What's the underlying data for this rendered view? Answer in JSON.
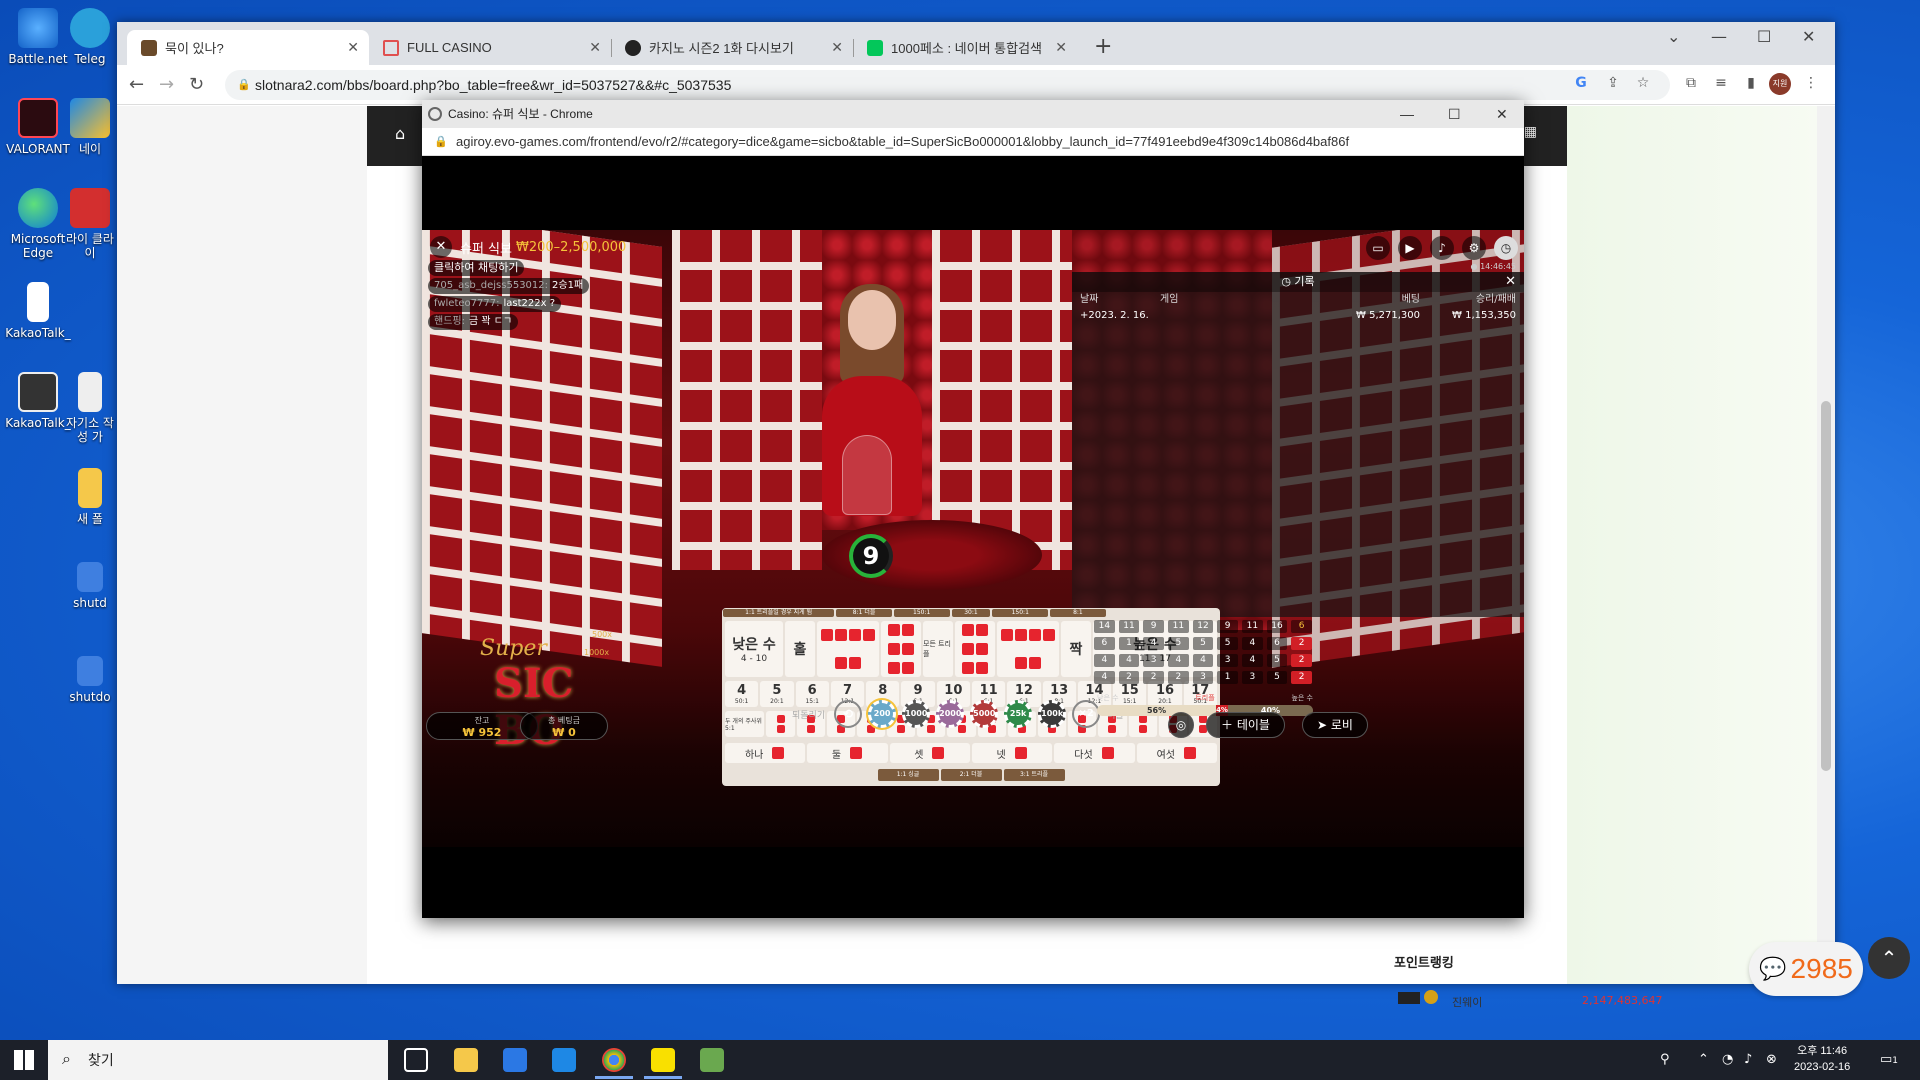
{
  "desktop": {
    "icons": [
      {
        "label": "Battle.net"
      },
      {
        "label": "Teleg"
      },
      {
        "label": "VALORANT"
      },
      {
        "label": "네이"
      },
      {
        "label": "Microsoft Edge"
      },
      {
        "label": "라이 클라이"
      },
      {
        "label": "KakaoTalk_"
      },
      {
        "label": "KakaoTalk_"
      },
      {
        "label": "자기소 작성 가"
      },
      {
        "label": "새 폴"
      },
      {
        "label": "shutd"
      },
      {
        "label": "shutdo"
      }
    ]
  },
  "browser": {
    "tabs": [
      {
        "title": "묵이 있나?",
        "fav_color": "#6a4a2a"
      },
      {
        "title": "FULL CASINO",
        "fav_color": "#e05050"
      },
      {
        "title": "카지노 시즌2 1화 다시보기",
        "fav_color": "#222222"
      },
      {
        "title": "1000페소 : 네이버 통합검색",
        "fav_color": "#03c75a"
      }
    ],
    "url": "slotnara2.com/bbs/board.php?bo_table=free&wr_id=5037527&&#c_5037535",
    "profile_label": "지원"
  },
  "page": {
    "ranking_title": "포인트랭킹",
    "ranking_row": {
      "name": "진웨이",
      "points": "2,147,483,647"
    },
    "chat_count": "2985"
  },
  "popup": {
    "title": "Casino: 슈퍼 식보 - Chrome",
    "url": "agiroy.evo-games.com/frontend/evo/r2/#category=dice&game=sicbo&table_id=SuperSicBo000001&lobby_launch_id=77f491eebd9e4f309c14b086d4baf86f"
  },
  "game": {
    "name": "슈퍼 식보",
    "limits": "₩200–2,500,000",
    "chat_prompt": "클릭하여 채팅하기",
    "chat_messages": [
      {
        "user": "705_asb_dejss553012:",
        "text": "2승1패"
      },
      {
        "user": "fwleteo7777:",
        "text": "last222x ?"
      },
      {
        "user": "핸드핑:",
        "text": "금 꽉 ㄷㄱ"
      }
    ],
    "timestamp": "● 14:46:45",
    "timer": "9",
    "history": {
      "title": "기록",
      "columns": [
        "날짜",
        "게임",
        "베팅",
        "승리/패배"
      ],
      "row": {
        "date": "+2023. 2. 16.",
        "game": "",
        "bet": "₩ 5,271,300",
        "result": "₩ 1,153,350"
      }
    },
    "board": {
      "top_labels": [
        "1:1 트리플일 경우 지게 됨",
        "8:1 더블",
        "150:1",
        "30:1",
        "150:1",
        "8:1"
      ],
      "small": {
        "label": "낮은 수",
        "range": "4 - 10"
      },
      "odd": "홀",
      "any_triple": "모든 트리플",
      "even": "짝",
      "big": {
        "label": "높은 수",
        "range": "11 - 17"
      },
      "totals": [
        {
          "n": "4",
          "pay": "50:1"
        },
        {
          "n": "5",
          "pay": "20:1"
        },
        {
          "n": "6",
          "pay": "15:1"
        },
        {
          "n": "7",
          "pay": "12:1"
        },
        {
          "n": "8",
          "pay": "8:1"
        },
        {
          "n": "9",
          "pay": "6:1"
        },
        {
          "n": "10",
          "pay": "6:1"
        },
        {
          "n": "11",
          "pay": "6:1"
        },
        {
          "n": "12",
          "pay": "6:1"
        },
        {
          "n": "13",
          "pay": "8:1"
        },
        {
          "n": "14",
          "pay": "12:1"
        },
        {
          "n": "15",
          "pay": "15:1"
        },
        {
          "n": "16",
          "pay": "20:1"
        },
        {
          "n": "17",
          "pay": "50:1"
        }
      ],
      "combo_label": "두 개의 주사위 5:1",
      "singles": [
        "하나",
        "둘",
        "셋",
        "넷",
        "다섯",
        "여섯"
      ],
      "bottom_labels": [
        "1:1 싱글",
        "2:1 더블",
        "3:1 트리플"
      ]
    },
    "logo": {
      "line1": "Super",
      "line2": "SIC BO",
      "mult1": "500x",
      "mult2": "1000x"
    },
    "balance": {
      "label": "잔고",
      "value": "₩ 952"
    },
    "total_bet": {
      "label": "총 베팅금",
      "value": "₩ 0"
    },
    "undo_label": "되돌리기",
    "double_label": "더블",
    "double_x": "×2",
    "chips": [
      {
        "label": "200",
        "color": "#6aa9c9"
      },
      {
        "label": "1000",
        "color": "#555555"
      },
      {
        "label": "2000",
        "color": "#9a6a9a"
      },
      {
        "label": "5000",
        "color": "#b33a3a"
      },
      {
        "label": "25k",
        "color": "#2f8a4a"
      },
      {
        "label": "100k",
        "color": "#3a3a3a"
      }
    ],
    "stats_grid": [
      [
        "14",
        "11",
        "9",
        "11",
        "12",
        "9",
        "11",
        "16",
        "6"
      ],
      [
        "6",
        "1",
        "4",
        "5",
        "5",
        "5",
        "4",
        "6",
        "2"
      ],
      [
        "4",
        "4",
        "3",
        "4",
        "4",
        "3",
        "4",
        "5",
        "2"
      ],
      [
        "4",
        "2",
        "2",
        "2",
        "3",
        "1",
        "3",
        "5",
        "2"
      ]
    ],
    "low_high": {
      "low_label": "낮은 수",
      "triple_label": "트리플",
      "high_label": "높은 수",
      "low_pct": "56%",
      "triple_pct": "4%",
      "high_pct": "40%",
      "low_frac": 0.56,
      "triple_frac": 0.04,
      "high_frac": 0.4
    },
    "table_button": "테이블",
    "lobby_button": "로비"
  },
  "taskbar": {
    "search_placeholder": "찾기",
    "time": "오후 11:46",
    "date": "2023-02-16",
    "notif_count": "1"
  }
}
